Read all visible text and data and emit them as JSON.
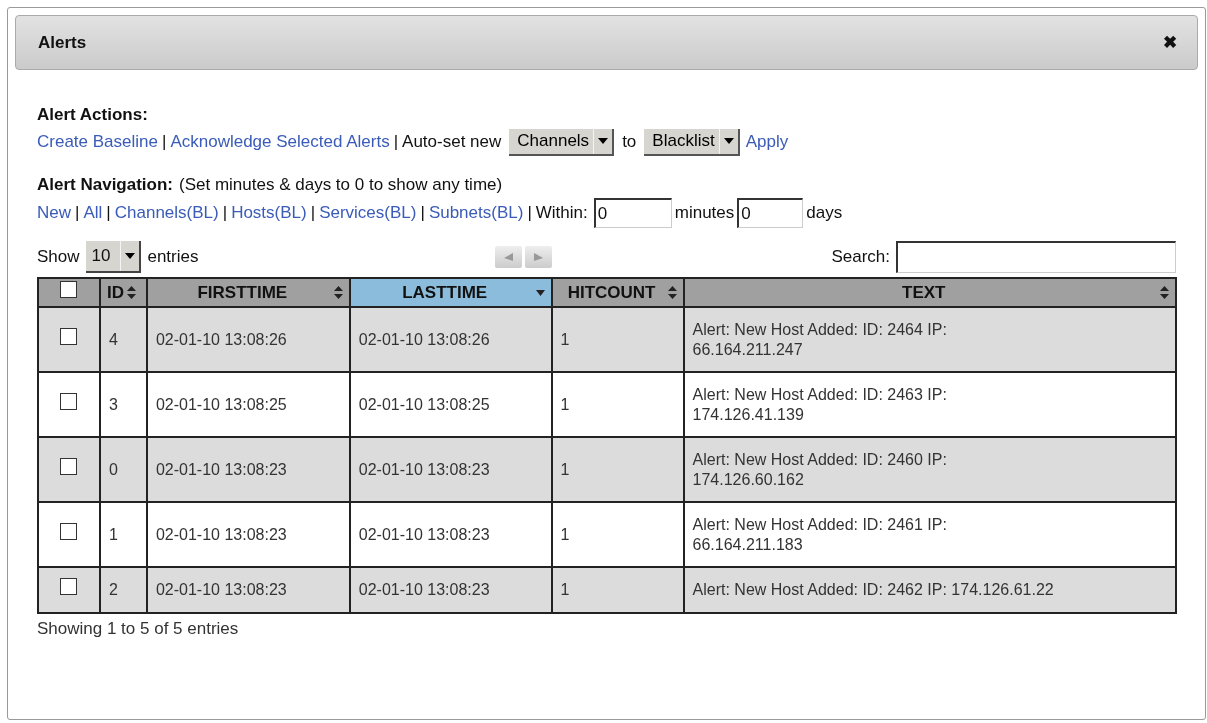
{
  "dialog": {
    "title": "Alerts",
    "close": "✖"
  },
  "actions": {
    "heading": "Alert Actions:",
    "links": [
      "Create Baseline",
      "Acknowledge Selected Alerts"
    ],
    "separators": [
      "|",
      "|"
    ],
    "autoset_label": "Auto-set new",
    "type_select": "Channels",
    "to_label": "to",
    "list_select": "Blacklist",
    "apply": "Apply"
  },
  "navigation": {
    "heading": "Alert Navigation:",
    "hint": "(Set minutes & days to 0 to show any time)",
    "links": [
      "New",
      "All",
      "Channels(BL)",
      "Hosts(BL)",
      "Services(BL)",
      "Subnets(BL)"
    ],
    "separators": [
      "|",
      "|",
      "|",
      "|",
      "|",
      "|"
    ],
    "within_label": "Within:",
    "minutes_value": "0",
    "minutes_label": "minutes",
    "days_value": "0",
    "days_label": "days"
  },
  "table_controls": {
    "show_label": "Show",
    "page_size": "10",
    "entries_label": "entries",
    "search_label": "Search:"
  },
  "table": {
    "select_all_checked": false,
    "columns": [
      {
        "label": "ID",
        "sorted": false
      },
      {
        "label": "FIRSTTIME",
        "sorted": false
      },
      {
        "label": "LASTTIME",
        "sorted": true
      },
      {
        "label": "HITCOUNT",
        "sorted": false
      },
      {
        "label": "TEXT",
        "sorted": false
      }
    ],
    "rows": [
      {
        "checked": false,
        "id": "4",
        "firsttime": "02-01-10 13:08:26",
        "lasttime": "02-01-10 13:08:26",
        "hitcount": "1",
        "text": [
          "Alert: New Host Added: ID: 2464 IP:",
          "66.164.211.247"
        ]
      },
      {
        "checked": false,
        "id": "3",
        "firsttime": "02-01-10 13:08:25",
        "lasttime": "02-01-10 13:08:25",
        "hitcount": "1",
        "text": [
          "Alert: New Host Added: ID: 2463 IP:",
          "174.126.41.139"
        ]
      },
      {
        "checked": false,
        "id": "0",
        "firsttime": "02-01-10 13:08:23",
        "lasttime": "02-01-10 13:08:23",
        "hitcount": "1",
        "text": [
          "Alert: New Host Added: ID: 2460 IP:",
          "174.126.60.162"
        ]
      },
      {
        "checked": false,
        "id": "1",
        "firsttime": "02-01-10 13:08:23",
        "lasttime": "02-01-10 13:08:23",
        "hitcount": "1",
        "text": [
          "Alert: New Host Added: ID: 2461 IP:",
          "66.164.211.183"
        ]
      },
      {
        "checked": false,
        "id": "2",
        "firsttime": "02-01-10 13:08:23",
        "lasttime": "02-01-10 13:08:23",
        "hitcount": "1",
        "text": [
          "Alert: New Host Added: ID: 2462 IP: 174.126.61.22"
        ]
      }
    ]
  },
  "info": "Showing 1 to 5 of 5 entries"
}
